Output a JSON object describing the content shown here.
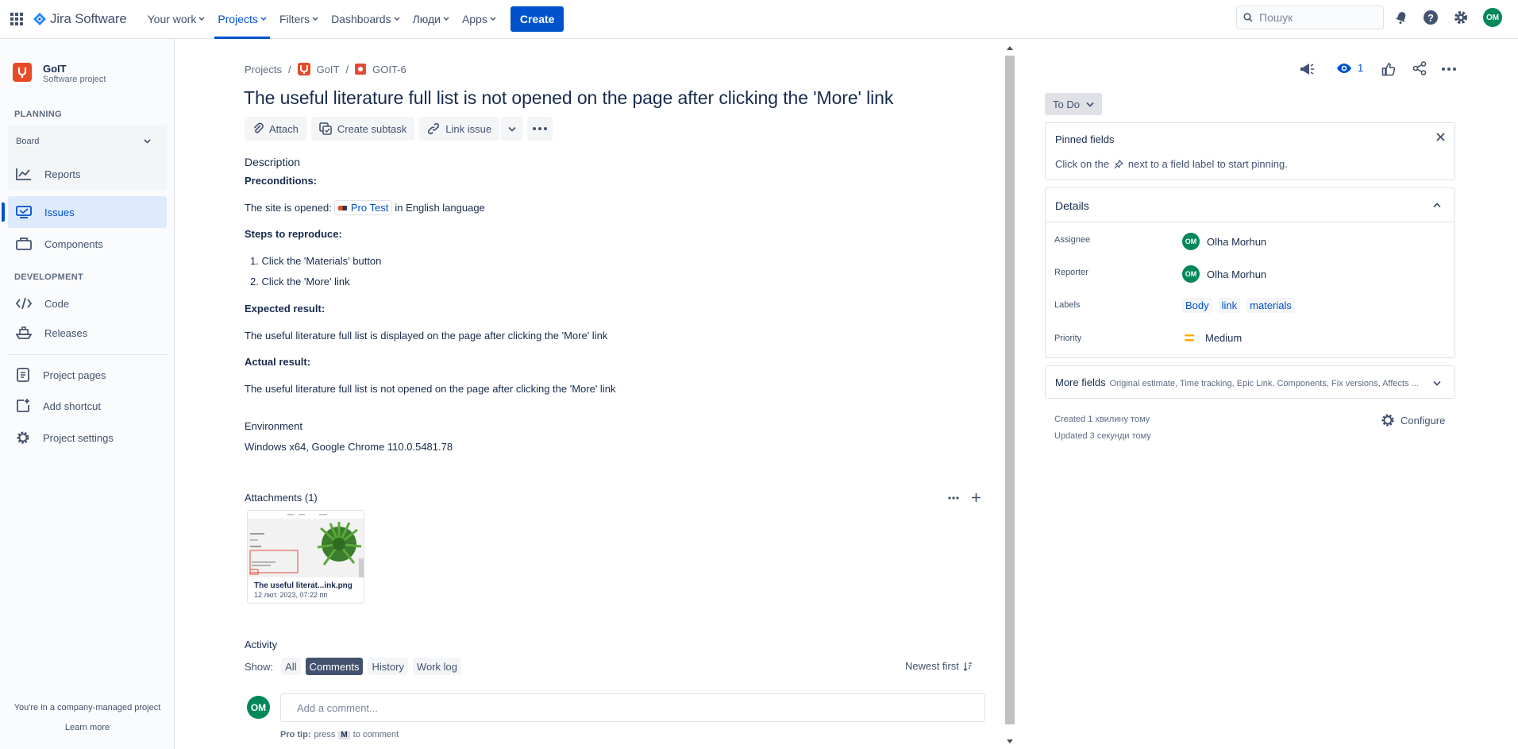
{
  "nav": {
    "product": "Jira Software",
    "items": [
      {
        "label": "Your work",
        "active": false
      },
      {
        "label": "Projects",
        "active": true
      },
      {
        "label": "Filters",
        "active": false
      },
      {
        "label": "Dashboards",
        "active": false
      },
      {
        "label": "Люди",
        "active": false
      },
      {
        "label": "Apps",
        "active": false
      }
    ],
    "create": "Create",
    "search_placeholder": "Пошук",
    "user_initials": "OM"
  },
  "sidebar": {
    "project_name": "GoIT",
    "project_type": "Software project",
    "planning_header": "PLANNING",
    "board_label": "Board",
    "reports": "Reports",
    "issues": "Issues",
    "components": "Components",
    "development_header": "DEVELOPMENT",
    "code": "Code",
    "releases": "Releases",
    "project_pages": "Project pages",
    "add_shortcut": "Add shortcut",
    "project_settings": "Project settings",
    "footer_text": "You're in a company-managed project",
    "learn_more": "Learn more"
  },
  "breadcrumb": {
    "projects": "Projects",
    "project": "GoIT",
    "issue_key": "GOIT-6"
  },
  "issue": {
    "title": "The useful literature full list is not opened on the page after clicking the 'More' link",
    "actions": {
      "attach": "Attach",
      "create_subtask": "Create subtask",
      "link_issue": "Link issue"
    },
    "description_label": "Description",
    "preconditions_label": "Preconditions:",
    "site_opened_prefix": "The site is opened:",
    "smart_link": "Pro Test",
    "site_opened_suffix": "in English language",
    "steps_label": "Steps to reproduce:",
    "steps": [
      "Click the 'Materials' button",
      "Click the 'More' link"
    ],
    "expected_label": "Expected result:",
    "expected": "The useful literature full list is displayed on the page after clicking the 'More' link",
    "actual_label": "Actual result:",
    "actual": "The useful literature full list is not opened on the page after clicking the 'More' link",
    "environment_label": "Environment",
    "environment": "Windows x64, Google Chrome 110.0.5481.78"
  },
  "attachments": {
    "title": "Attachments (1)",
    "file_name": "The useful literat...ink.png",
    "file_date": "12 лют. 2023, 07:22 пп"
  },
  "activity": {
    "title": "Activity",
    "show_label": "Show:",
    "tabs": [
      {
        "label": "All",
        "selected": false
      },
      {
        "label": "Comments",
        "selected": true
      },
      {
        "label": "History",
        "selected": false
      },
      {
        "label": "Work log",
        "selected": false
      }
    ],
    "sort": "Newest first",
    "comment_placeholder": "Add a comment...",
    "user_initials": "OM",
    "tip_prefix": "Pro tip:",
    "tip_press": "press",
    "tip_key": "M",
    "tip_suffix": "to comment"
  },
  "right": {
    "watchers_count": "1",
    "status": "To Do",
    "pinned_title": "Pinned fields",
    "pinned_hint_prefix": "Click on the",
    "pinned_hint_suffix": "next to a field label to start pinning.",
    "details_title": "Details",
    "fields": {
      "assignee_label": "Assignee",
      "assignee": "Olha Morhun",
      "reporter_label": "Reporter",
      "reporter": "Olha Morhun",
      "labels_label": "Labels",
      "labels": [
        "Body",
        "link",
        "materials"
      ],
      "priority_label": "Priority",
      "priority": "Medium",
      "avatar_initials": "OM"
    },
    "more_fields_title": "More fields",
    "more_fields_list": "Original estimate, Time tracking, Epic Link, Components, Fix versions, Affects ...",
    "created": "Created 1 хвилину тому",
    "updated": "Updated 3 секунди тому",
    "configure": "Configure"
  },
  "colors": {
    "brand": "#0052cc",
    "avatar": "#00875a",
    "project": "#e84a27",
    "priority_medium": "#ffab00"
  }
}
